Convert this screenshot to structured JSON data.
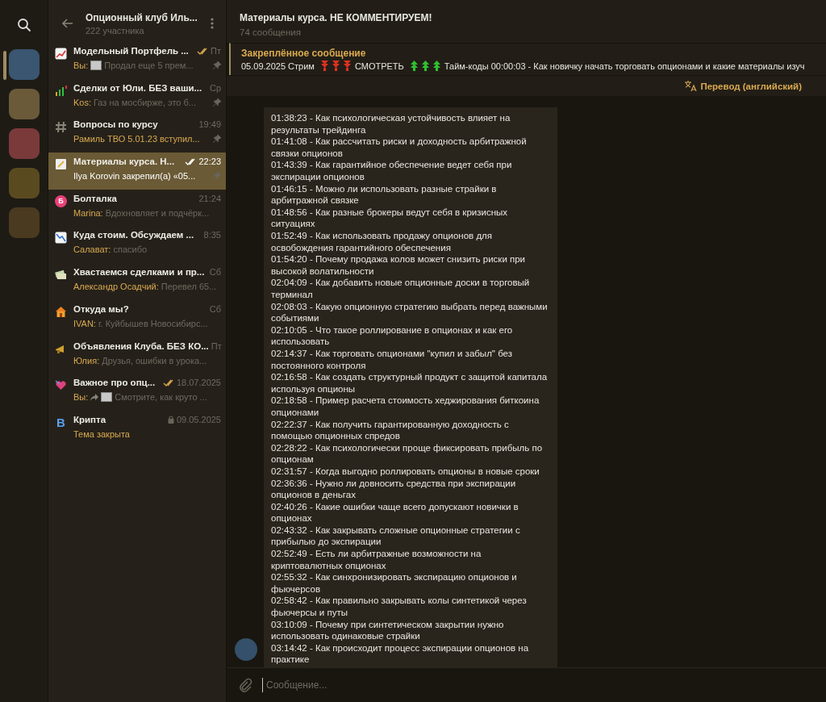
{
  "rail": {
    "folders": [
      {
        "selected": true
      },
      {
        "selected": false
      },
      {
        "selected": false
      },
      {
        "selected": false
      },
      {
        "selected": false
      }
    ]
  },
  "group": {
    "title": "Опционный клуб Иль...",
    "subtitle": "222 участника"
  },
  "chats": [
    {
      "kind": "chart-up",
      "title": "Модельный Портфель ...",
      "time": "Пт",
      "read": true,
      "pinned": true,
      "locked": false,
      "selected": false,
      "service": false,
      "sender": "Вы:",
      "attachments": [
        {
          "kind": "image"
        }
      ],
      "text": "Продал еще 5 прем..."
    },
    {
      "kind": "bars",
      "title": "Сделки от Юли. БЕЗ ваши...",
      "time": "Ср",
      "read": false,
      "pinned": true,
      "locked": false,
      "selected": false,
      "service": false,
      "sender": "Kos:",
      "text": "Газ на мосбирже, это б..."
    },
    {
      "kind": "hash",
      "title": "Вопросы по курсу",
      "time": "19:49",
      "read": false,
      "pinned": true,
      "locked": false,
      "selected": false,
      "service": true,
      "text": "Рамиль ТВО 5.01.23 вступил..."
    },
    {
      "kind": "memo",
      "title": "Материалы курса. Н...",
      "time": "22:23",
      "read": true,
      "pinned": true,
      "locked": false,
      "selected": true,
      "service": true,
      "text": "Ilya Korovin закрепил(а) «05..."
    },
    {
      "kind": "letter-badge",
      "letter": "Б",
      "title": "Болталка",
      "time": "21:24",
      "read": false,
      "pinned": false,
      "locked": false,
      "selected": false,
      "service": false,
      "sender": "Marina:",
      "text": "Вдохновляет и подчёрк..."
    },
    {
      "kind": "chart-down",
      "title": "Куда стоим. Обсуждаем ...",
      "time": "8:35",
      "read": false,
      "pinned": false,
      "locked": false,
      "selected": false,
      "service": false,
      "sender": "Салават:",
      "text": "спасибо"
    },
    {
      "kind": "money",
      "title": "Хвастаемся сделками и пр...",
      "time": "Сб",
      "read": false,
      "pinned": false,
      "locked": false,
      "selected": false,
      "service": false,
      "sender": "Александр Осадчий:",
      "text": "Перевел 65..."
    },
    {
      "kind": "house",
      "title": "Откуда мы?",
      "time": "Сб",
      "read": false,
      "pinned": false,
      "locked": false,
      "selected": false,
      "service": false,
      "sender": "IVAN:",
      "text": "г. Куйбышев Новосибирс..."
    },
    {
      "kind": "megaphone",
      "title": "Объявления Клуба. БЕЗ КО...",
      "time": "Пт",
      "read": false,
      "pinned": false,
      "locked": false,
      "selected": false,
      "service": false,
      "sender": "Юлия:",
      "text": "Друзья, ошибки в урока..."
    },
    {
      "kind": "heart",
      "title": "Важное про опц...",
      "time": "18.07.2025",
      "read": true,
      "pinned": false,
      "locked": false,
      "selected": false,
      "service": false,
      "sender": "Вы:",
      "attachments": [
        {
          "kind": "forward"
        },
        {
          "kind": "image"
        }
      ],
      "text": "Смотрите, как круто ..."
    },
    {
      "kind": "letter",
      "letter": "B",
      "title": "Крипта",
      "time": "09.05.2025",
      "read": false,
      "pinned": false,
      "locked": true,
      "selected": false,
      "service": true,
      "text": "Тема закрыта"
    }
  ],
  "topic": {
    "title": "Материалы курса. НЕ КОММЕНТИРУЕМ!",
    "subtitle": "74 сообщения"
  },
  "pinned": {
    "label": "Закреплённое сообщение",
    "segments": [
      {
        "kind": "text",
        "text": "05.09.2025 Стрим"
      },
      {
        "kind": "down-arrow"
      },
      {
        "kind": "down-arrow"
      },
      {
        "kind": "down-arrow"
      },
      {
        "kind": "text",
        "text": "СМОТРЕТЬ"
      },
      {
        "kind": "up-arrow"
      },
      {
        "kind": "up-arrow"
      },
      {
        "kind": "up-arrow"
      },
      {
        "kind": "text",
        "text": "Тайм-коды 00:00:03 - Как новичку начать торговать опционами и какие материалы изуч"
      }
    ]
  },
  "translate": {
    "label": "Перевод (английский)"
  },
  "message": {
    "lines": [
      "01:38:23 - Как психологическая устойчивость влияет на результаты трейдинга",
      "01:41:08 - Как рассчитать риски и доходность арбитражной связки опционов",
      "01:43:39 - Как гарантийное обеспечение ведет себя при экспирации опционов",
      "01:46:15 - Можно ли использовать разные страйки в арбитражной связке",
      "01:48:56 - Как разные брокеры ведут себя в кризисных ситуациях",
      "01:52:49 - Как использовать продажу опционов для освобождения гарантийного обеспечения",
      "01:54:20 - Почему продажа колов может снизить риски при высокой волатильности",
      "02:04:09 - Как добавить новые опционные доски в торговый терминал",
      "02:08:03 - Какую опционную стратегию выбрать перед важными событиями",
      "02:10:05 - Что такое роллирование в опционах и как его использовать",
      "02:14:37 - Как торговать опционами \"купил и забыл\" без постоянного контроля",
      "02:16:58 - Как создать структурный продукт с защитой капитала используя опционы",
      "02:18:58 - Пример расчета стоимость хеджирования биткоина опционами",
      "02:22:37 - Как получить гарантированную доходность с помощью опционных спредов",
      "02:28:22 - Как психологически проще фиксировать прибыль по опционам",
      "02:31:57 - Когда выгодно роллировать опционы в новые сроки",
      "02:36:36 - Нужно ли довносить средства при экспирации опционов в деньгах",
      "02:40:26 - Какие ошибки чаще всего допускают новички в опционах",
      "02:43:32 - Как закрывать сложные опционные стратегии с прибылью до экспирации",
      "02:52:49 - Есть ли арбитражные возможности на криптовалютных опционах",
      "02:55:32 - Как синхронизировать экспирацию опционов и фьючерсов",
      "02:58:42 - Как правильно закрывать колы синтетикой через фьючерсы и путы",
      "03:10:09 - Почему при синтетическом закрытии нужно использовать одинаковые страйки",
      "03:14:42 - Как происходит процесс экспирации опционов на практике"
    ]
  },
  "composer": {
    "placeholder": "Сообщение..."
  }
}
